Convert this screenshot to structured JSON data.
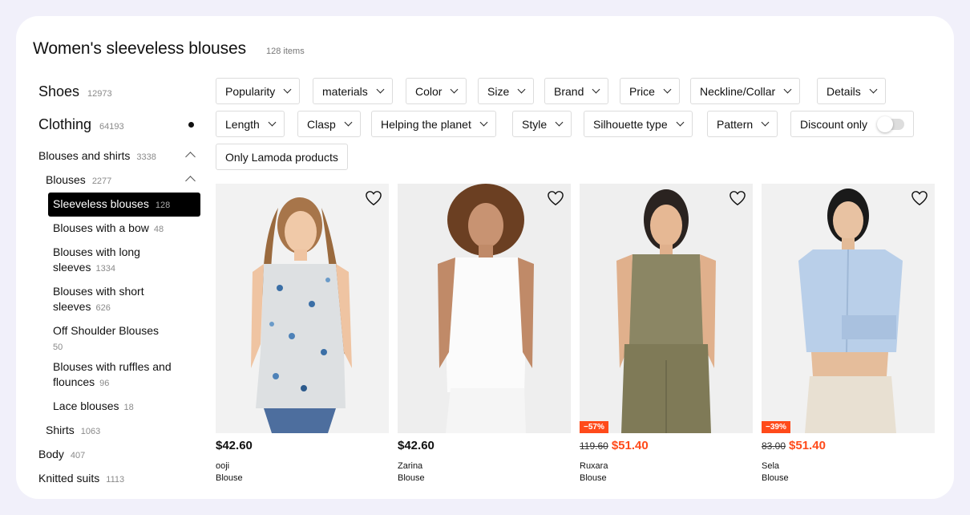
{
  "header": {
    "title": "Women's sleeveless blouses",
    "count": "128 items"
  },
  "sidebar": {
    "shoes": {
      "label": "Shoes",
      "count": "12973"
    },
    "clothing": {
      "label": "Clothing",
      "count": "64193"
    },
    "blouses_shirts": {
      "label": "Blouses and shirts",
      "count": "3338"
    },
    "blouses": {
      "label": "Blouses",
      "count": "2277"
    },
    "sleeveless": {
      "label": "Sleeveless blouses",
      "count": "128"
    },
    "bow": {
      "label": "Blouses with a bow",
      "count": "48"
    },
    "long1": "Blouses with long",
    "long2": "sleeves",
    "long_count": "1334",
    "short1": "Blouses with short",
    "short2": "sleeves",
    "short_count": "626",
    "off1": "Off Shoulder Blouses",
    "off_count": "50",
    "ruffles1": "Blouses with ruffles and",
    "ruffles2": "flounces",
    "ruffles_count": "96",
    "lace": {
      "label": "Lace blouses",
      "count": "18"
    },
    "shirts": {
      "label": "Shirts",
      "count": "1063"
    },
    "body": {
      "label": "Body",
      "count": "407"
    },
    "knitted": {
      "label": "Knitted suits",
      "count": "1113"
    }
  },
  "filters": {
    "popularity": "Popularity",
    "materials": "materials",
    "color": "Color",
    "size": "Size",
    "brand": "Brand",
    "price": "Price",
    "neckline": "Neckline/Collar",
    "details": "Details",
    "length": "Length",
    "clasp": "Clasp",
    "planet": "Helping the planet",
    "style": "Style",
    "silhouette": "Silhouette type",
    "pattern": "Pattern",
    "discount": "Discount only",
    "lamoda": "Only Lamoda products"
  },
  "products": [
    {
      "price": "$42.60",
      "old_price": "",
      "discount": "",
      "brand": "ooji",
      "type": "Blouse"
    },
    {
      "price": "$42.60",
      "old_price": "",
      "discount": "",
      "brand": "Zarina",
      "type": "Blouse"
    },
    {
      "price": "$51.40",
      "old_price": "119.60",
      "discount": "−57%",
      "brand": "Ruxara",
      "type": "Blouse"
    },
    {
      "price": "$51.40",
      "old_price": "83.00",
      "discount": "−39%",
      "brand": "Sela",
      "type": "Blouse"
    }
  ],
  "colors": {
    "accent": "#ff4a1a",
    "background": "#f1f0fa",
    "active": "#000000"
  },
  "icons": {
    "favorite": "heart-icon",
    "expand": "chevron-down-icon",
    "collapse": "chevron-up-icon"
  }
}
